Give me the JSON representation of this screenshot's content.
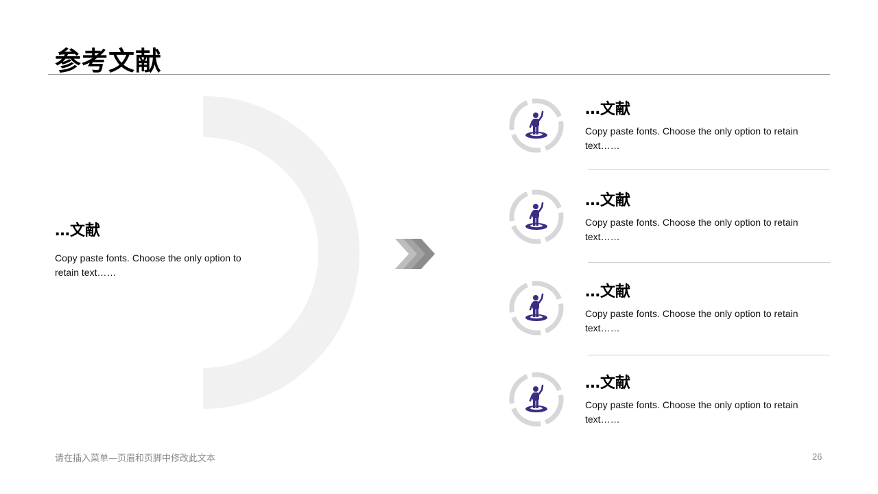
{
  "slide": {
    "title": "参考文献",
    "left": {
      "heading": "…文献",
      "text": "Copy paste fonts. Choose the only option to retain text……"
    },
    "items": [
      {
        "heading": "…文献",
        "text": "Copy paste fonts. Choose the only option to retain text……",
        "icon": "person-on-platform-icon"
      },
      {
        "heading": "…文献",
        "text": "Copy paste fonts. Choose the only option to retain text……",
        "icon": "person-on-platform-icon"
      },
      {
        "heading": "…文献",
        "text": "Copy paste fonts. Choose the only option to retain text……",
        "icon": "person-on-platform-icon"
      },
      {
        "heading": "…文献",
        "text": "Copy paste fonts. Choose the only option to retain text……",
        "icon": "person-on-platform-icon"
      }
    ],
    "footer": "请在插入菜单—页眉和页脚中修改此文本",
    "page_number": "26"
  },
  "colors": {
    "accent": "#3d2c84",
    "ring": "#d7d7d9",
    "arc": "#f1f1f1",
    "chevron_dark": "#8c8c8c",
    "chevron_light": "#bdbdbd"
  }
}
